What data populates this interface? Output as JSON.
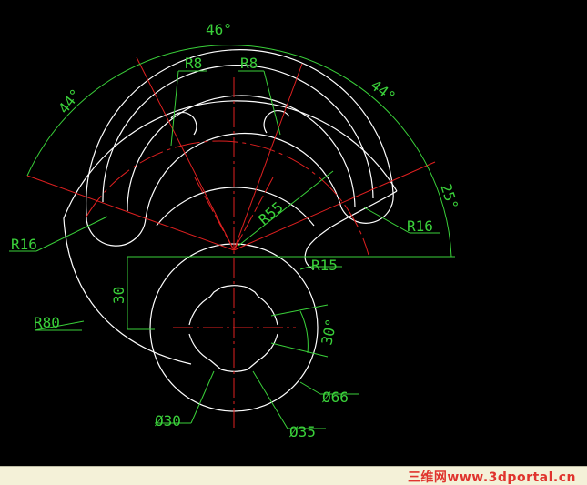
{
  "drawing": {
    "angles": {
      "top": "46°",
      "left": "44°",
      "right": "44°",
      "side": "25°",
      "slot": "30°"
    },
    "radii": {
      "r8_left": "R8",
      "r8_right": "R8",
      "r16_left": "R16",
      "r16_right": "R16",
      "r55": "R55",
      "r15": "R15",
      "r80": "R80"
    },
    "lengths": {
      "d30": "30"
    },
    "diameters": {
      "d66": "Ø66",
      "d35": "Ø35",
      "d30": "Ø30"
    },
    "colors": {
      "outline": "#ffffff",
      "center": "#e02020",
      "dimension": "#3ad13a",
      "background": "#000000"
    }
  },
  "footer": {
    "watermark": "三维网www.3dportal.cn"
  }
}
